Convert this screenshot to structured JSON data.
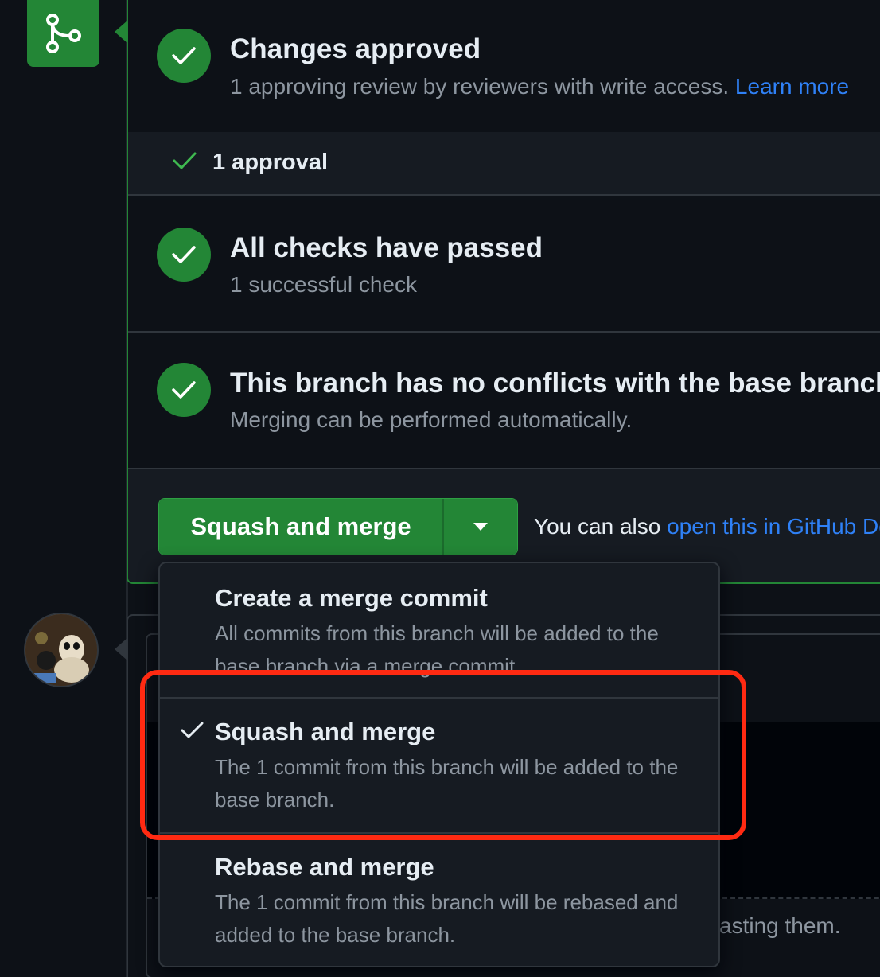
{
  "reviews": {
    "title": "Changes approved",
    "subtitle": "1 approving review by reviewers with write access.",
    "learn_more": "Learn more",
    "approvals_label": "1 approval"
  },
  "checks": {
    "title": "All checks have passed",
    "subtitle": "1 successful check"
  },
  "conflicts": {
    "title": "This branch has no conflicts with the base branch",
    "subtitle": "Merging can be performed automatically."
  },
  "merge_action": {
    "button_label": "Squash and merge",
    "also_text": "You can also ",
    "also_link": "open this in GitHub Desktop"
  },
  "merge_menu": {
    "options": [
      {
        "title": "Create a merge commit",
        "description": "All commits from this branch will be added to the base branch via a merge commit.",
        "selected": false
      },
      {
        "title": "Squash and merge",
        "description": "The 1 commit from this branch will be added to the base branch.",
        "selected": true
      },
      {
        "title": "Rebase and merge",
        "description": "The 1 commit from this branch will be rebased and added to the base branch.",
        "selected": false
      }
    ]
  },
  "comment": {
    "behind_text": "asting them."
  },
  "colors": {
    "success": "#238636",
    "link": "#2f81f7",
    "highlight": "#ff2a12",
    "background": "#0d1117"
  }
}
